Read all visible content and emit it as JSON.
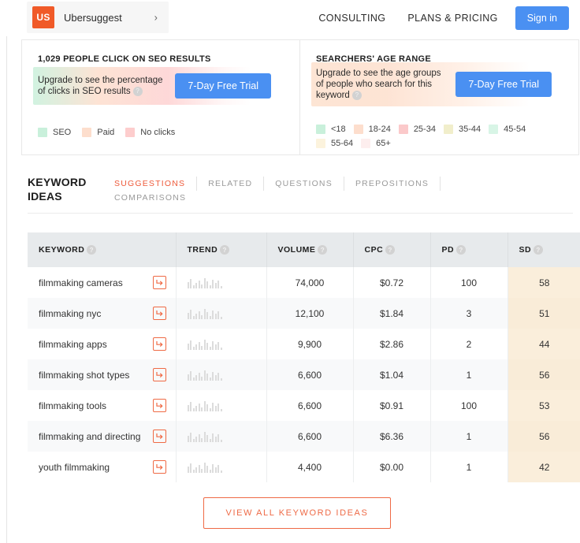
{
  "colors": {
    "brand_orange": "#f05a28",
    "accent_orange": "#ee5a3a",
    "primary_blue": "#4a90f2",
    "sd_highlight": "#faeedb",
    "header_gray": "#e7eaec"
  },
  "topnav": {
    "brand_badge": "US",
    "brand_name": "Ubersuggest",
    "chevron_icon": "chevron-right-icon",
    "links": [
      {
        "label": "CONSULTING"
      },
      {
        "label": "PLANS & PRICING"
      }
    ],
    "signin_label": "Sign in"
  },
  "cards": [
    {
      "title": "1,029 PEOPLE CLICK ON SEO RESULTS",
      "upgrade_text": "Upgrade to see the percentage of clicks in SEO results",
      "help_icon": "question-mark-icon",
      "cta_label": "7-Day Free Trial",
      "legend": [
        {
          "label": "SEO",
          "color": "#c9f0db"
        },
        {
          "label": "Paid",
          "color": "#fddecd"
        },
        {
          "label": "No clicks",
          "color": "#fdcdcd"
        }
      ]
    },
    {
      "title": "SEARCHERS' AGE RANGE",
      "upgrade_text": "Upgrade to see the age groups of people who search for this keyword",
      "help_icon": "question-mark-icon",
      "cta_label": "7-Day Free Trial",
      "legend": [
        {
          "label": "<18",
          "color": "#c9f0db"
        },
        {
          "label": "18-24",
          "color": "#fddecd"
        },
        {
          "label": "25-34",
          "color": "#fbc9ca"
        },
        {
          "label": "35-44",
          "color": "#f1eecb"
        },
        {
          "label": "45-54",
          "color": "#d8f5e6"
        },
        {
          "label": "55-64",
          "color": "#fcf3dd"
        },
        {
          "label": "65+",
          "color": "#fdeeee"
        }
      ]
    }
  ],
  "keyword_ideas": {
    "section_title_line1": "KEYWORD",
    "section_title_line2": "IDEAS",
    "tabs": [
      {
        "label": "SUGGESTIONS",
        "active": true
      },
      {
        "label": "RELATED",
        "active": false
      },
      {
        "label": "QUESTIONS",
        "active": false
      },
      {
        "label": "PREPOSITIONS",
        "active": false
      },
      {
        "label": "COMPARISONS",
        "active": false
      }
    ],
    "columns": [
      {
        "label": "KEYWORD",
        "help": "question-mark-icon"
      },
      {
        "label": "TREND",
        "help": "question-mark-icon"
      },
      {
        "label": "VOLUME",
        "help": "question-mark-icon"
      },
      {
        "label": "CPC",
        "help": "question-mark-icon"
      },
      {
        "label": "PD",
        "help": "question-mark-icon"
      },
      {
        "label": "SD",
        "help": "question-mark-icon"
      }
    ],
    "rows": [
      {
        "keyword": "filmmaking cameras",
        "trend_icon": "sparkline-icon",
        "volume": "74,000",
        "cpc": "$0.72",
        "pd": "100",
        "sd": "58"
      },
      {
        "keyword": "filmmaking nyc",
        "trend_icon": "sparkline-icon",
        "volume": "12,100",
        "cpc": "$1.84",
        "pd": "3",
        "sd": "51"
      },
      {
        "keyword": "filmmaking apps",
        "trend_icon": "sparkline-icon",
        "volume": "9,900",
        "cpc": "$2.86",
        "pd": "2",
        "sd": "44"
      },
      {
        "keyword": "filmmaking shot types",
        "trend_icon": "sparkline-icon",
        "volume": "6,600",
        "cpc": "$1.04",
        "pd": "1",
        "sd": "56"
      },
      {
        "keyword": "filmmaking tools",
        "trend_icon": "sparkline-icon",
        "volume": "6,600",
        "cpc": "$0.91",
        "pd": "100",
        "sd": "53"
      },
      {
        "keyword": "filmmaking and directing",
        "trend_icon": "sparkline-icon",
        "volume": "6,600",
        "cpc": "$6.36",
        "pd": "1",
        "sd": "56"
      },
      {
        "keyword": "youth filmmaking",
        "trend_icon": "sparkline-icon",
        "volume": "4,400",
        "cpc": "$0.00",
        "pd": "1",
        "sd": "42"
      }
    ],
    "row_action_icon": "open-keyword-arrow-icon",
    "view_all_label": "VIEW ALL KEYWORD IDEAS"
  },
  "sparkline_values": [
    7,
    11,
    4,
    6,
    9,
    5,
    12,
    8,
    4,
    10,
    6,
    9,
    3
  ]
}
